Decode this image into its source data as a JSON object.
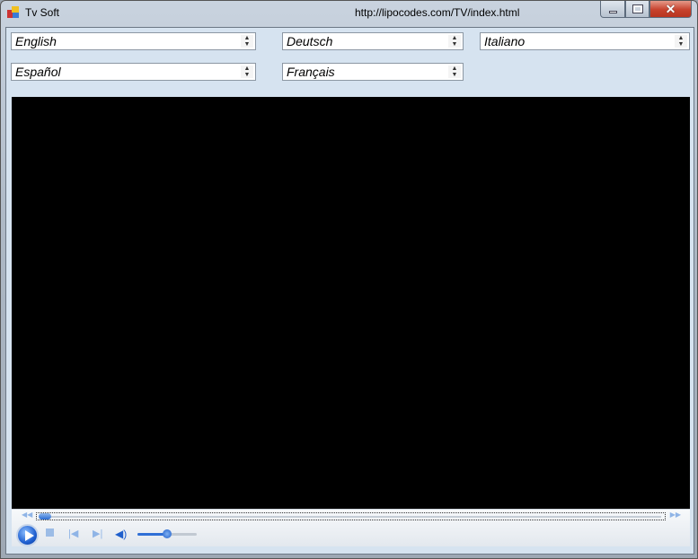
{
  "window": {
    "title": "Tv Soft",
    "url": "http://lipocodes.com/TV/index.html"
  },
  "languages": [
    "English",
    "Deutsch",
    "Italiano",
    "Español",
    "Français"
  ],
  "player": {
    "seek_position": 0.0,
    "volume": 0.5,
    "accent": "#2a6bd1"
  }
}
